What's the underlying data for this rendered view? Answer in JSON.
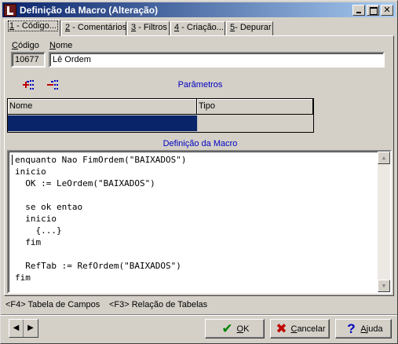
{
  "window": {
    "title": "Definição da Macro (Alteração)"
  },
  "tabs": [
    {
      "label": "1 - Código...",
      "hotkey": "1",
      "rest": " - Código..."
    },
    {
      "label": "2 - Comentários",
      "hotkey": "2",
      "rest": " - Comentários"
    },
    {
      "label": "3 - Filtros",
      "hotkey": "3",
      "rest": " - Filtros"
    },
    {
      "label": "4 - Criação...",
      "hotkey": "4",
      "rest": " - Criação..."
    },
    {
      "label": "5- Depurar",
      "hotkey": "5",
      "rest": "- Depurar"
    }
  ],
  "fields": {
    "codigo_label": "Código",
    "codigo_hotkey": "C",
    "codigo_rest": "ódigo",
    "codigo_value": "10677",
    "nome_label": "Nome",
    "nome_hotkey": "N",
    "nome_rest": "ome",
    "nome_value": "Lê Ordem"
  },
  "parametros": {
    "title": "Parâmetros",
    "columns": [
      "Nome",
      "Tipo"
    ]
  },
  "macro": {
    "title": "Definição da Macro",
    "lines": [
      "enquanto Nao FimOrdem(\"BAIXADOS\")",
      "inicio",
      "  OK := LeOrdem(\"BAIXADOS\")",
      "",
      "  se ok entao",
      "  inicio",
      "    {...}",
      "  fim",
      "",
      "  RefTab := RefOrdem(\"BAIXADOS\")",
      "fim"
    ]
  },
  "status": {
    "f4": "<F4> Tabela de Campos",
    "f3": "<F3> Relação de Tabelas"
  },
  "buttons": {
    "ok": {
      "hotkey": "O",
      "rest": "K"
    },
    "cancelar": {
      "hotkey": "C",
      "rest": "ancelar"
    },
    "ajuda": {
      "hotkey": "A",
      "rest": "juda"
    }
  },
  "colors": {
    "titlebar_start": "#0a246a",
    "titlebar_end": "#a6caf0",
    "grid_selection": "#0a246a",
    "accent_blue": "#0000c0"
  },
  "icons": [
    "minimize-icon",
    "maximize-icon",
    "close-icon",
    "add-parameter-icon",
    "remove-parameter-icon",
    "arrow-left-icon",
    "arrow-right-icon",
    "checkmark-icon",
    "cross-icon",
    "question-icon"
  ]
}
